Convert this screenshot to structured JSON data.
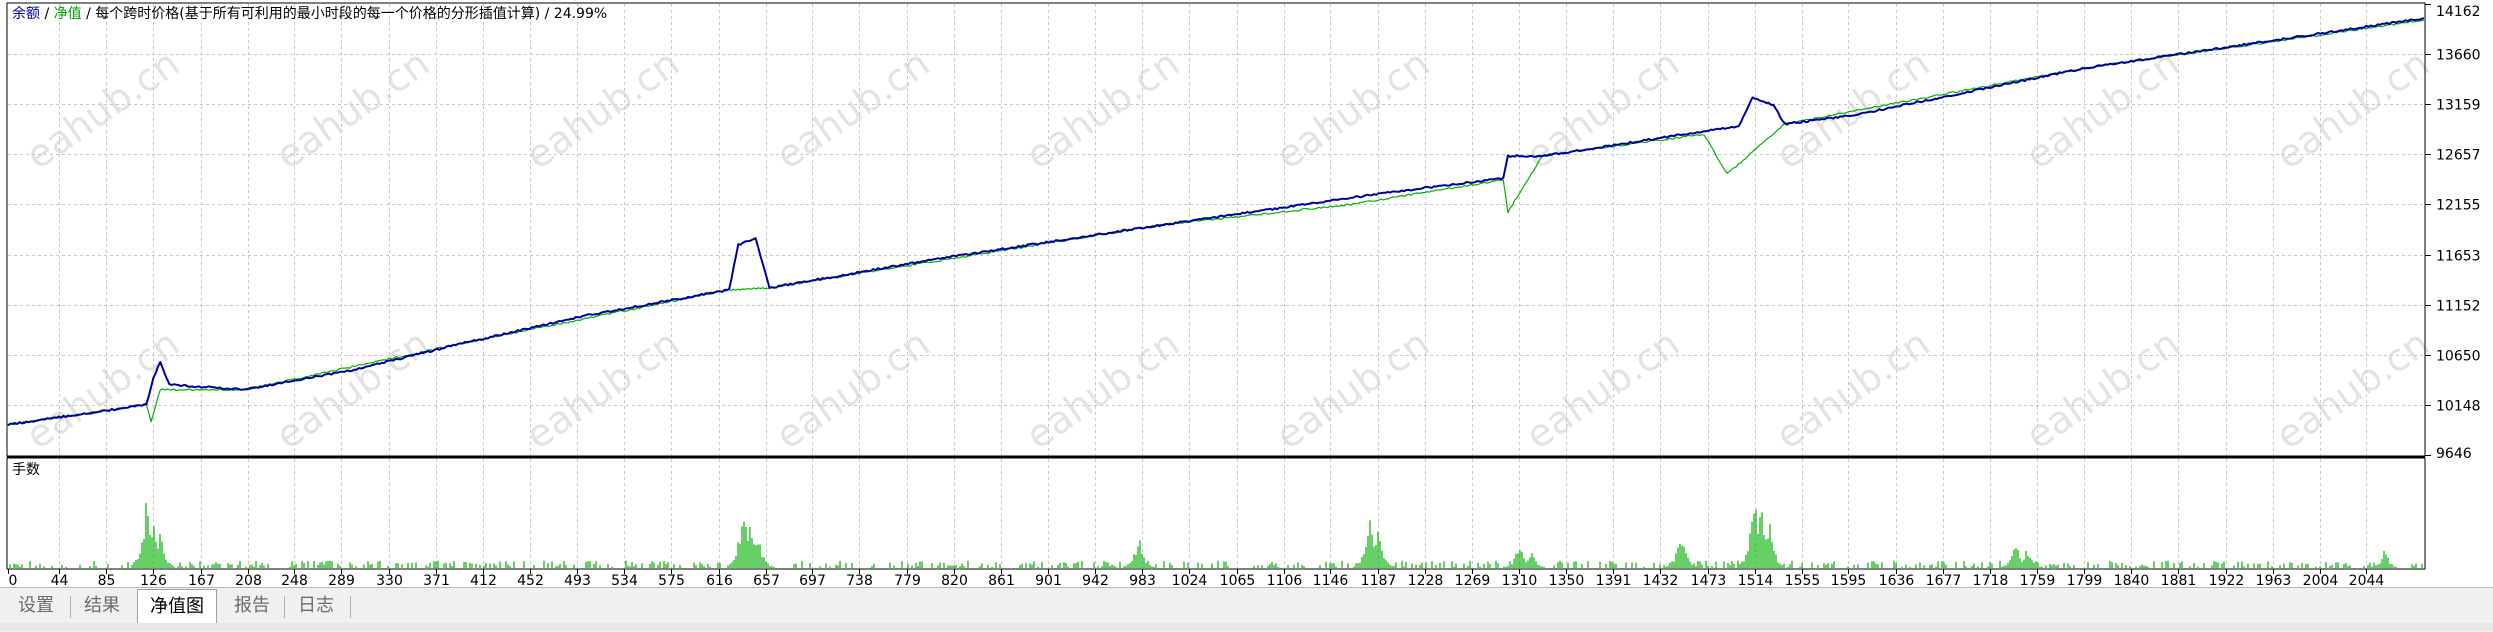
{
  "header": {
    "balance_label": "余额",
    "sep1": " / ",
    "equity_label": "净值",
    "sep2": " / ",
    "description": "每个跨时价格(基于所有可利用的最小时段的每一个价格的分形插值计算) / 24.99%"
  },
  "colors": {
    "balance": "#0000a0",
    "equity": "#00b000",
    "volume": "#00b000",
    "grid": "#c8c8c8",
    "watermark": "#d9d9d9"
  },
  "watermark_text": "eahub.cn",
  "volume_panel": {
    "label": "手数"
  },
  "chart_data": {
    "type": "line",
    "title": "",
    "series": [
      {
        "name": "余额",
        "color": "#0000a0",
        "points": [
          [
            0,
            9950
          ],
          [
            120,
            10150
          ],
          [
            126,
            10420
          ],
          [
            132,
            10580
          ],
          [
            140,
            10350
          ],
          [
            205,
            10300
          ],
          [
            300,
            10500
          ],
          [
            400,
            10780
          ],
          [
            500,
            11040
          ],
          [
            625,
            11300
          ],
          [
            633,
            11750
          ],
          [
            648,
            11820
          ],
          [
            660,
            11320
          ],
          [
            800,
            11600
          ],
          [
            1000,
            11950
          ],
          [
            1200,
            12280
          ],
          [
            1296,
            12420
          ],
          [
            1300,
            12640
          ],
          [
            1330,
            12640
          ],
          [
            1500,
            12940
          ],
          [
            1512,
            13220
          ],
          [
            1530,
            13150
          ],
          [
            1540,
            12960
          ],
          [
            1600,
            13050
          ],
          [
            1800,
            13520
          ],
          [
            2000,
            13860
          ],
          [
            2094,
            14020
          ]
        ]
      },
      {
        "name": "净值",
        "color": "#00b000",
        "points": [
          [
            0,
            9950
          ],
          [
            120,
            10150
          ],
          [
            124,
            9980
          ],
          [
            132,
            10300
          ],
          [
            205,
            10300
          ],
          [
            400,
            10780
          ],
          [
            625,
            11300
          ],
          [
            660,
            11320
          ],
          [
            1000,
            11950
          ],
          [
            1160,
            12150
          ],
          [
            1296,
            12400
          ],
          [
            1300,
            12080
          ],
          [
            1330,
            12640
          ],
          [
            1470,
            12860
          ],
          [
            1490,
            12460
          ],
          [
            1540,
            12960
          ],
          [
            1780,
            13480
          ],
          [
            1800,
            13520
          ],
          [
            2094,
            14000
          ]
        ]
      }
    ],
    "y_ticks": [
      14162,
      13660,
      13159,
      12657,
      12155,
      11653,
      11152,
      10650,
      10148,
      9646
    ],
    "ylim": [
      9646,
      14162
    ],
    "x_ticks": [
      0,
      44,
      85,
      126,
      167,
      208,
      248,
      289,
      330,
      371,
      412,
      452,
      493,
      534,
      575,
      616,
      657,
      697,
      738,
      779,
      820,
      861,
      901,
      942,
      983,
      1024,
      1065,
      1106,
      1146,
      1187,
      1228,
      1269,
      1310,
      1350,
      1391,
      1432,
      1473,
      1514,
      1555,
      1595,
      1636,
      1677,
      1718,
      1759,
      1799,
      1840,
      1881,
      1922,
      1963,
      2004,
      2044
    ],
    "xlim": [
      0,
      2094
    ],
    "volume": {
      "label": "手数",
      "spikes": [
        [
          120,
          0.78
        ],
        [
          126,
          0.6
        ],
        [
          132,
          0.4
        ],
        [
          637,
          0.78
        ],
        [
          644,
          0.62
        ],
        [
          650,
          0.4
        ],
        [
          980,
          0.4
        ],
        [
          1180,
          0.62
        ],
        [
          1187,
          0.5
        ],
        [
          1310,
          0.3
        ],
        [
          1320,
          0.2
        ],
        [
          1450,
          0.48
        ],
        [
          1514,
          1.0
        ],
        [
          1520,
          0.8
        ],
        [
          1527,
          0.5
        ],
        [
          1740,
          0.3
        ],
        [
          1750,
          0.22
        ],
        [
          2060,
          0.2
        ]
      ]
    },
    "grid": true
  },
  "tabs": [
    {
      "label": "设置",
      "active": false
    },
    {
      "label": "结果",
      "active": false
    },
    {
      "label": "净值图",
      "active": true
    },
    {
      "label": "报告",
      "active": false
    },
    {
      "label": "日志",
      "active": false
    }
  ]
}
